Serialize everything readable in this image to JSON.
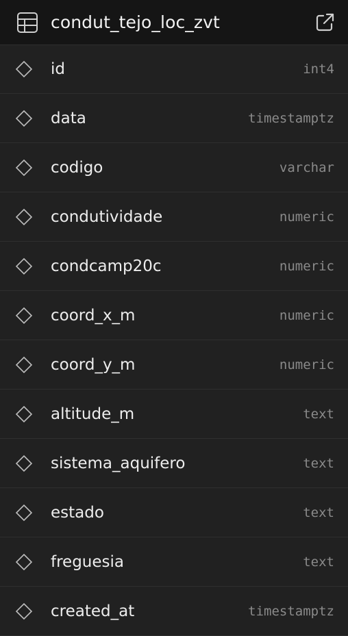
{
  "header": {
    "title": "condut_tejo_loc_zvt",
    "table_icon": "table-icon",
    "open_icon": "external-link-icon"
  },
  "columns": [
    {
      "name": "id",
      "type": "int4"
    },
    {
      "name": "data",
      "type": "timestamptz"
    },
    {
      "name": "codigo",
      "type": "varchar"
    },
    {
      "name": "condutividade",
      "type": "numeric"
    },
    {
      "name": "condcamp20c",
      "type": "numeric"
    },
    {
      "name": "coord_x_m",
      "type": "numeric"
    },
    {
      "name": "coord_y_m",
      "type": "numeric"
    },
    {
      "name": "altitude_m",
      "type": "text"
    },
    {
      "name": "sistema_aquifero",
      "type": "text"
    },
    {
      "name": "estado",
      "type": "text"
    },
    {
      "name": "freguesia",
      "type": "text"
    },
    {
      "name": "created_at",
      "type": "timestamptz"
    }
  ],
  "colors": {
    "header_bg": "#151515",
    "row_bg": "#212121",
    "divider": "#2f2f2f",
    "text": "#ededed",
    "type_text": "#8a8a8a"
  }
}
